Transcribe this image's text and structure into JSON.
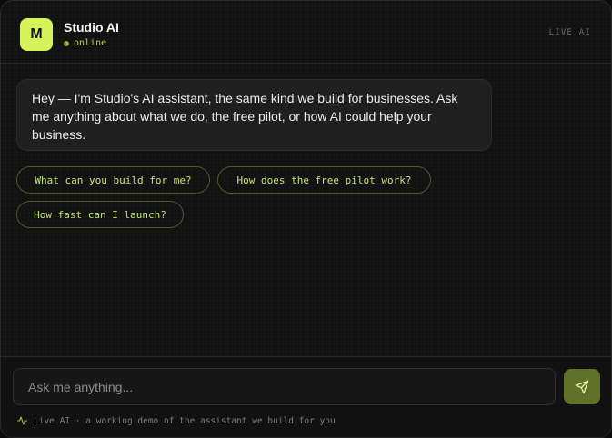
{
  "header": {
    "avatar_letter": "M",
    "title": "Studio AI",
    "status": "online",
    "badge": "LIVE AI"
  },
  "messages": [
    {
      "role": "assistant",
      "text": "Hey — I'm Studio's AI assistant, the same kind we build for businesses. Ask me anything about what we do, the free pilot, or how AI could help your business."
    }
  ],
  "suggestions": [
    "What can you build for me?",
    "How does the free pilot work?",
    "How fast can I launch?"
  ],
  "composer": {
    "placeholder": "Ask me anything...",
    "value": ""
  },
  "footer": {
    "text": "Live AI · a working demo of the assistant we build for you"
  },
  "icons": {
    "send": "send-icon",
    "footer": "activity-pulse-icon"
  },
  "colors": {
    "accent": "#d7f35a",
    "accent_text": "#c6e46a",
    "send_button": "#5f7228",
    "background": "#121212"
  }
}
